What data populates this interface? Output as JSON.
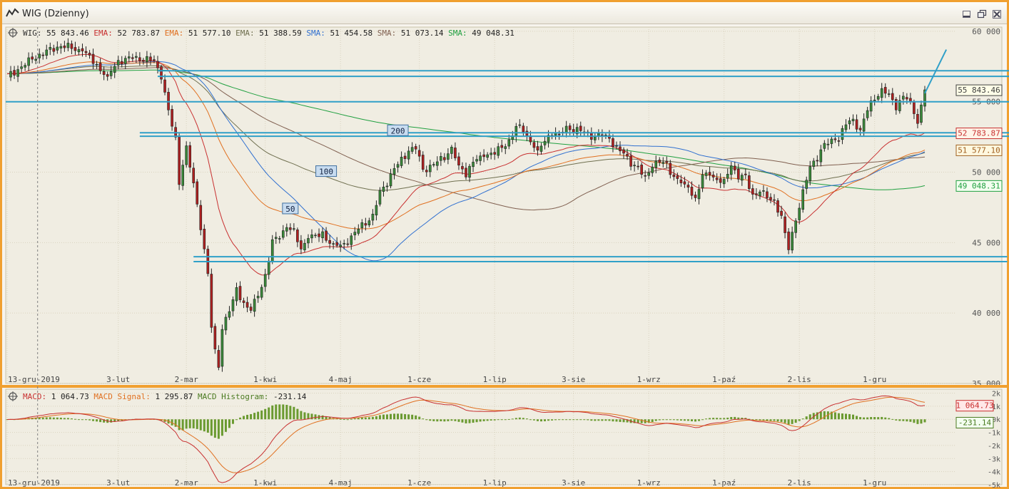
{
  "window": {
    "title": "WIG (Dzienny)",
    "minimize_icon": "minimize-icon",
    "restore_icon": "restore-icon",
    "close_icon": "close-icon"
  },
  "legend": {
    "main": [
      {
        "label": "WIG:",
        "value": "55 843.46",
        "color": "#333333"
      },
      {
        "label": "EMA:",
        "value": "52 783.87",
        "color": "#c83030"
      },
      {
        "label": "EMA:",
        "value": "51 577.10",
        "color": "#e07020"
      },
      {
        "label": "EMA:",
        "value": "51 388.59",
        "color": "#707050"
      },
      {
        "label": "SMA:",
        "value": "51 454.58",
        "color": "#3070d0"
      },
      {
        "label": "SMA:",
        "value": "51 073.14",
        "color": "#806050"
      },
      {
        "label": "SMA:",
        "value": "49 048.31",
        "color": "#20a040"
      }
    ],
    "macd": [
      {
        "label": "MACD:",
        "value": "1 064.73",
        "color": "#c83030"
      },
      {
        "label": "MACD Signal:",
        "value": "1 295.87",
        "color": "#e07020"
      },
      {
        "label": "MACD Histogram:",
        "value": "-231.14",
        "color": "#4a7a20"
      }
    ]
  },
  "value_tags": [
    {
      "value": "55 843.46",
      "at": 55843,
      "color": "#404040",
      "fill": "#ffffe8"
    },
    {
      "value": "52 783.87",
      "at": 52784,
      "color": "#c83030",
      "fill": "#fff4e8"
    },
    {
      "value": "51 577.10",
      "at": 51577,
      "color": "#a06020",
      "fill": "#fff8e0"
    },
    {
      "value": "49 048.31",
      "at": 49048,
      "color": "#20a040",
      "fill": "#f4fff0"
    }
  ],
  "macd_tags": [
    {
      "value": "1 064.73",
      "at": 1065,
      "color": "#c83030",
      "fill": "#ffe8e8"
    },
    {
      "value": "-231.14",
      "at": -231,
      "color": "#4a7a20",
      "fill": "#f4fff0"
    }
  ],
  "ma_labels": [
    {
      "text": "200",
      "date_index": 109,
      "value": 52950
    },
    {
      "text": "100",
      "date_index": 89,
      "value": 50050
    },
    {
      "text": "50",
      "date_index": 79,
      "value": 47400
    }
  ],
  "chart_data": {
    "type": "line",
    "title": "WIG (Dzienny)",
    "x_tick_labels": [
      "13-gru-2019",
      "3-lut",
      "2-mar",
      "1-kwi",
      "4-maj",
      "1-cze",
      "1-lip",
      "3-sie",
      "1-wrz",
      "1-paź",
      "2-lis",
      "1-gru"
    ],
    "x_tick_index": [
      0,
      31,
      50,
      72,
      93,
      115,
      136,
      158,
      179,
      200,
      221,
      242
    ],
    "price_axis": {
      "ticks": [
        "60 000",
        "55 000",
        "50 000",
        "45 000",
        "40 000",
        "35 000"
      ],
      "tick_values": [
        60000,
        55000,
        50000,
        45000,
        40000,
        35000
      ],
      "ylim": [
        35000,
        60300
      ]
    },
    "macd_axis": {
      "ticks": [
        "2k",
        "1k",
        "0k",
        "-1k",
        "-2k",
        "-3k",
        "-4k",
        "-5k"
      ],
      "tick_values": [
        2000,
        1000,
        0,
        -1000,
        -2000,
        -3000,
        -4000,
        -5000
      ],
      "ylim": [
        -5000,
        2300
      ]
    },
    "close_anchors": [
      [
        0,
        56800
      ],
      [
        3,
        57300
      ],
      [
        8,
        58200
      ],
      [
        15,
        59000
      ],
      [
        21,
        58600
      ],
      [
        25,
        57600
      ],
      [
        28,
        56800
      ],
      [
        31,
        57900
      ],
      [
        36,
        58100
      ],
      [
        41,
        57900
      ],
      [
        43,
        56900
      ],
      [
        45,
        54300
      ],
      [
        47,
        52300
      ],
      [
        48,
        49300
      ],
      [
        50,
        51700
      ],
      [
        52,
        49100
      ],
      [
        54,
        46200
      ],
      [
        56,
        42800
      ],
      [
        57,
        39000
      ],
      [
        58,
        37200
      ],
      [
        59,
        36300
      ],
      [
        60,
        39000
      ],
      [
        62,
        40200
      ],
      [
        64,
        41700
      ],
      [
        66,
        40700
      ],
      [
        68,
        40200
      ],
      [
        70,
        41200
      ],
      [
        72,
        42700
      ],
      [
        74,
        45000
      ],
      [
        76,
        45500
      ],
      [
        78,
        46200
      ],
      [
        80,
        45700
      ],
      [
        82,
        44600
      ],
      [
        84,
        45300
      ],
      [
        86,
        45400
      ],
      [
        88,
        45700
      ],
      [
        90,
        45000
      ],
      [
        93,
        44800
      ],
      [
        96,
        45300
      ],
      [
        99,
        46300
      ],
      [
        102,
        46800
      ],
      [
        104,
        48600
      ],
      [
        106,
        49300
      ],
      [
        108,
        50200
      ],
      [
        110,
        50900
      ],
      [
        112,
        51500
      ],
      [
        114,
        51700
      ],
      [
        116,
        50200
      ],
      [
        118,
        50400
      ],
      [
        120,
        50700
      ],
      [
        122,
        51100
      ],
      [
        124,
        51700
      ],
      [
        126,
        50500
      ],
      [
        128,
        49900
      ],
      [
        130,
        50800
      ],
      [
        132,
        50900
      ],
      [
        134,
        51300
      ],
      [
        136,
        51400
      ],
      [
        138,
        51700
      ],
      [
        140,
        52300
      ],
      [
        142,
        53200
      ],
      [
        144,
        53000
      ],
      [
        146,
        52200
      ],
      [
        148,
        51300
      ],
      [
        150,
        52300
      ],
      [
        152,
        52800
      ],
      [
        154,
        52700
      ],
      [
        156,
        53200
      ],
      [
        158,
        53000
      ],
      [
        160,
        52900
      ],
      [
        162,
        52700
      ],
      [
        164,
        52500
      ],
      [
        166,
        52600
      ],
      [
        168,
        52400
      ],
      [
        170,
        51700
      ],
      [
        172,
        51300
      ],
      [
        174,
        50700
      ],
      [
        176,
        50300
      ],
      [
        178,
        49500
      ],
      [
        180,
        50600
      ],
      [
        182,
        50700
      ],
      [
        184,
        50500
      ],
      [
        186,
        49700
      ],
      [
        188,
        49300
      ],
      [
        190,
        49000
      ],
      [
        192,
        48100
      ],
      [
        194,
        49700
      ],
      [
        196,
        49800
      ],
      [
        198,
        49500
      ],
      [
        200,
        49200
      ],
      [
        202,
        50600
      ],
      [
        204,
        49700
      ],
      [
        206,
        49600
      ],
      [
        208,
        48400
      ],
      [
        210,
        48600
      ],
      [
        212,
        48200
      ],
      [
        214,
        48000
      ],
      [
        216,
        46800
      ],
      [
        218,
        44600
      ],
      [
        220,
        46700
      ],
      [
        222,
        48500
      ],
      [
        224,
        50400
      ],
      [
        226,
        51100
      ],
      [
        228,
        51900
      ],
      [
        230,
        52200
      ],
      [
        232,
        52400
      ],
      [
        234,
        53400
      ],
      [
        236,
        53700
      ],
      [
        238,
        53000
      ],
      [
        240,
        54400
      ],
      [
        242,
        55300
      ],
      [
        244,
        55800
      ],
      [
        246,
        55400
      ],
      [
        248,
        54700
      ],
      [
        250,
        55400
      ],
      [
        252,
        55000
      ],
      [
        254,
        53600
      ],
      [
        256,
        55800
      ]
    ],
    "series": [
      {
        "name": "WIG",
        "type": "candlestick",
        "last": 55843.46
      },
      {
        "name": "EMA",
        "last": 52783.87,
        "color": "#c83030"
      },
      {
        "name": "EMA",
        "last": 51577.1,
        "color": "#e07020"
      },
      {
        "name": "EMA",
        "last": 51388.59,
        "color": "#707050"
      },
      {
        "name": "SMA",
        "last": 51454.58,
        "color": "#3070d0"
      },
      {
        "name": "SMA",
        "last": 51073.14,
        "color": "#806050"
      },
      {
        "name": "SMA",
        "last": 49048.31,
        "color": "#20a040"
      },
      {
        "name": "MACD",
        "last": 1064.73,
        "color": "#c83030"
      },
      {
        "name": "MACD Signal",
        "last": 1295.87,
        "color": "#e07020"
      },
      {
        "name": "MACD Histogram",
        "last": -231.14,
        "color": "#4a7a20"
      }
    ],
    "horizontal_lines": [
      {
        "x0": 42,
        "x1": 292,
        "value": 57200
      },
      {
        "x0": 42,
        "x1": 292,
        "value": 56800
      },
      {
        "x0": 0,
        "x1": 292,
        "value": 55000
      },
      {
        "x0": 37,
        "x1": 292,
        "value": 52800
      },
      {
        "x0": 37,
        "x1": 292,
        "value": 52550
      },
      {
        "x0": 52,
        "x1": 279,
        "value": 44000
      },
      {
        "x0": 52,
        "x1": 279,
        "value": 43650
      }
    ],
    "trend_line": [
      {
        "x": 256,
        "value": 55600
      },
      {
        "x": 262,
        "value": 58700
      }
    ],
    "grid": true
  }
}
